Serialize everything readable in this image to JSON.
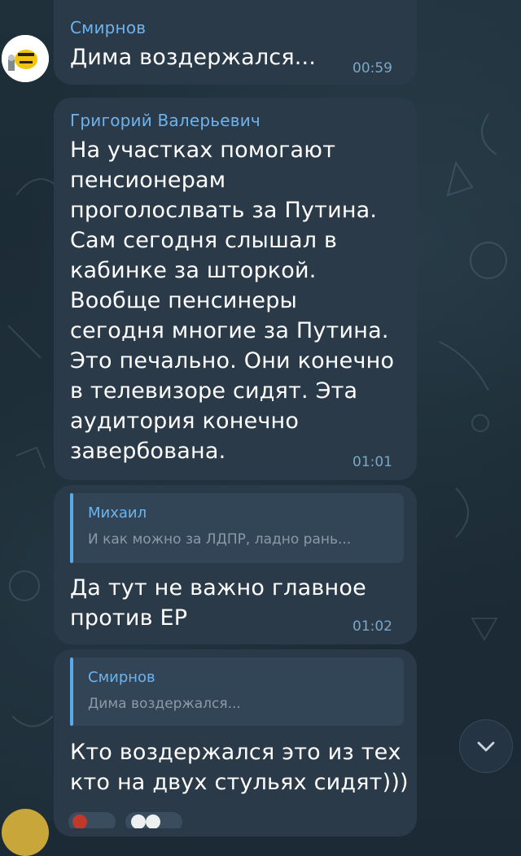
{
  "messages": [
    {
      "sender": "Смирнов",
      "text": "Дима воздержался...",
      "time": "00:59"
    },
    {
      "sender": "Григорий Валерьевич",
      "lines": [
        "На участках помогают",
        "пенсионерам",
        "проголослвать за Путина.",
        "Сам сегодня слышал в",
        "кабинке за шторкой.",
        "Вообще пенсинеры",
        "сегодня многие за Путина.",
        "Это печально. Они конечно",
        "в телевизоре сидят. Эта",
        "аудитория конечно",
        "завербована."
      ],
      "time": "01:01"
    },
    {
      "reply": {
        "name": "Михаил",
        "text": "И как можно за ЛДПР, ладно рань..."
      },
      "lines": [
        "Да тут не важно главное",
        "против ЕР"
      ],
      "time": "01:02"
    },
    {
      "reply": {
        "name": "Смирнов",
        "text": "Дима воздержался..."
      },
      "lines": [
        "Кто воздержался это из тех",
        "кто на двух стульях сидят)))"
      ]
    }
  ],
  "icons": {
    "scroll_down": "chevron-down-icon"
  },
  "colors": {
    "bubble": "#2a3a48",
    "reply_bg": "#324556",
    "accent": "#6db3ee",
    "time": "#7aa7c7"
  }
}
